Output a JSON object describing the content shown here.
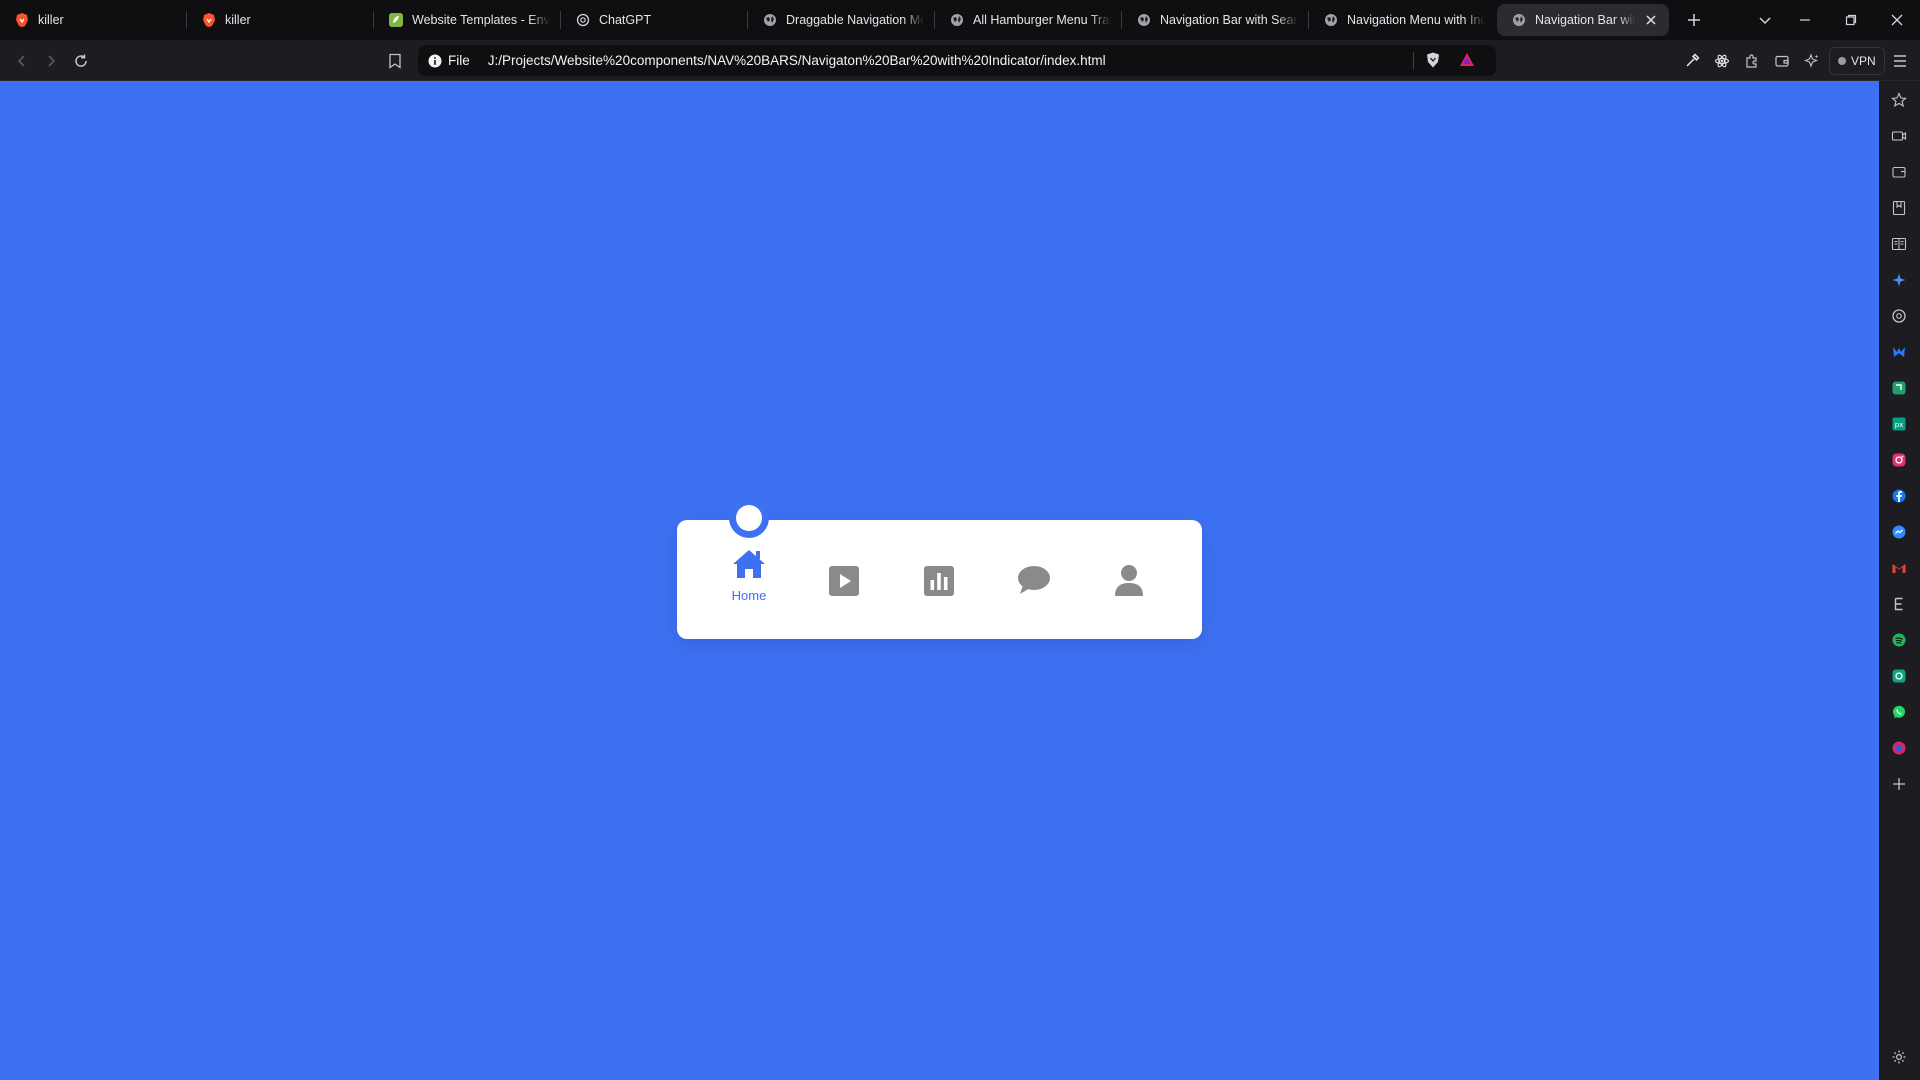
{
  "browser": {
    "tabs": [
      {
        "title": "killer",
        "icon": "brave-lion-icon",
        "active": false
      },
      {
        "title": "killer",
        "icon": "brave-lion-icon",
        "active": false
      },
      {
        "title": "Website Templates - Enva",
        "icon": "envato-leaf-icon",
        "active": false
      },
      {
        "title": "ChatGPT",
        "icon": "chatgpt-logo-icon",
        "active": false
      },
      {
        "title": "Draggable Navigation Me",
        "icon": "globe-icon",
        "active": false
      },
      {
        "title": "All Hamburger Menu Tran",
        "icon": "globe-icon",
        "active": false
      },
      {
        "title": "Navigation Bar with Searc",
        "icon": "globe-icon",
        "active": false
      },
      {
        "title": "Navigation Menu with Ind",
        "icon": "globe-icon",
        "active": false
      },
      {
        "title": "Navigation Bar with I",
        "icon": "globe-icon",
        "active": true
      }
    ],
    "address": {
      "scheme_label": "File",
      "url": "J:/Projects/Website%20components/NAV%20BARS/Navigaton%20Bar%20with%20Indicator/index.html"
    },
    "vpn_label": "VPN",
    "sidebar_icons": [
      "favorites-icon",
      "video-icon",
      "wallet-icon",
      "bookmarks-icon",
      "reading-list-icon",
      "leo-ai-icon",
      "chatgpt-icon",
      "malwarebytes-icon",
      "app-icon",
      "pixel-icon",
      "instagram-icon",
      "facebook-icon",
      "messenger-icon",
      "gmail-icon",
      "e-icon",
      "spotify-icon",
      "threads-icon",
      "whatsapp-icon",
      "app-red-icon",
      "add-panel-icon"
    ]
  },
  "nav": {
    "items": [
      {
        "id": "home",
        "icon": "home-icon",
        "label": "Home",
        "active": true
      },
      {
        "id": "play",
        "icon": "play-icon",
        "label": "",
        "active": false
      },
      {
        "id": "stats",
        "icon": "bar-chart-icon",
        "label": "",
        "active": false
      },
      {
        "id": "chat",
        "icon": "chat-bubble-icon",
        "label": "",
        "active": false
      },
      {
        "id": "profile",
        "icon": "user-icon",
        "label": "",
        "active": false
      }
    ],
    "colors": {
      "accent": "#3e71f2",
      "inactive": "#8a8a8a",
      "card": "#ffffff"
    }
  }
}
